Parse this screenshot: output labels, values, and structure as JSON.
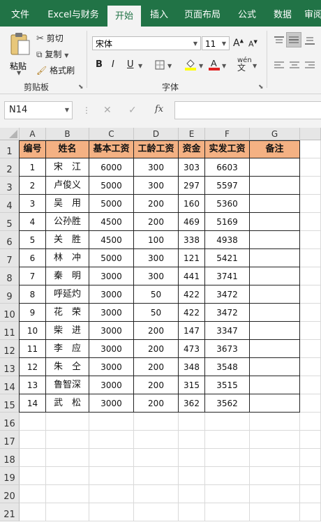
{
  "ribbon_tabs": [
    "文件",
    "Excel与财务",
    "开始",
    "插入",
    "页面布局",
    "公式",
    "数据",
    "审阅"
  ],
  "active_tab": "开始",
  "clipboard": {
    "paste": "粘贴",
    "cut": "剪切",
    "copy": "复制",
    "format_painter": "格式刷",
    "group": "剪贴板"
  },
  "font": {
    "name": "宋体",
    "size": "11",
    "bold": "B",
    "italic": "I",
    "underline": "U",
    "group": "字体"
  },
  "formula_bar": {
    "name_box": "N14",
    "cancel": "✕",
    "enter": "✓",
    "fx": "fx",
    "value": ""
  },
  "columns": [
    "A",
    "B",
    "C",
    "D",
    "E",
    "F",
    "G"
  ],
  "rows": [
    "1",
    "2",
    "3",
    "4",
    "5",
    "6",
    "7",
    "8",
    "9",
    "10",
    "11",
    "12",
    "13",
    "14",
    "15",
    "16",
    "17",
    "18",
    "19",
    "20",
    "21"
  ],
  "table": {
    "headers": [
      "编号",
      "姓名",
      "基本工资",
      "工龄工资",
      "资金",
      "实发工资",
      "备注"
    ],
    "data": [
      [
        "1",
        "宋　江",
        "6000",
        "300",
        "303",
        "6603",
        ""
      ],
      [
        "2",
        "卢俊义",
        "5000",
        "300",
        "297",
        "5597",
        ""
      ],
      [
        "3",
        "吴　用",
        "5000",
        "200",
        "160",
        "5360",
        ""
      ],
      [
        "4",
        "公孙胜",
        "4500",
        "200",
        "469",
        "5169",
        ""
      ],
      [
        "5",
        "关　胜",
        "4500",
        "100",
        "338",
        "4938",
        ""
      ],
      [
        "6",
        "林　冲",
        "5000",
        "300",
        "121",
        "5421",
        ""
      ],
      [
        "7",
        "秦　明",
        "3000",
        "300",
        "441",
        "3741",
        ""
      ],
      [
        "8",
        "呼延灼",
        "3000",
        "50",
        "422",
        "3472",
        ""
      ],
      [
        "9",
        "花　荣",
        "3000",
        "50",
        "422",
        "3472",
        ""
      ],
      [
        "10",
        "柴　进",
        "3000",
        "200",
        "147",
        "3347",
        ""
      ],
      [
        "11",
        "李　应",
        "3000",
        "200",
        "473",
        "3673",
        ""
      ],
      [
        "12",
        "朱　仝",
        "3000",
        "200",
        "348",
        "3548",
        ""
      ],
      [
        "13",
        "鲁智深",
        "3000",
        "200",
        "315",
        "3515",
        ""
      ],
      [
        "14",
        "武　松",
        "3000",
        "200",
        "362",
        "3562",
        ""
      ]
    ]
  },
  "colors": {
    "excel_green": "#217346",
    "header_fill": "#f4b183",
    "font_color_bar": "#e02020",
    "fill_color_bar": "#ffff00"
  }
}
